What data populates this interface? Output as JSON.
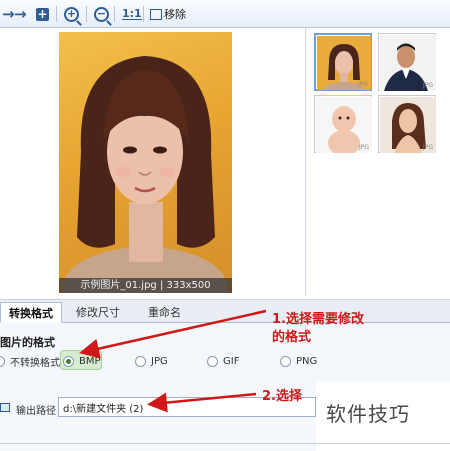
{
  "toolbar": {
    "icons": [
      "arrow-right-icon",
      "add-icon",
      "zoom-in-icon",
      "zoom-out-icon",
      "actual-size-icon",
      "remove-icon"
    ],
    "actual_size_label": "1:1",
    "remove_label": "移除"
  },
  "preview": {
    "caption": "示例图片_01.jpg | 333x500"
  },
  "thumbnails": [
    {
      "badge": "JPG"
    },
    {
      "badge": "JPG"
    },
    {
      "badge": "JPG"
    },
    {
      "badge": "JPG"
    }
  ],
  "tabs": [
    {
      "label": "转换格式",
      "active": true
    },
    {
      "label": "修改尺寸",
      "active": false
    },
    {
      "label": "重命名",
      "active": false
    }
  ],
  "format_section": {
    "title": "图片的格式",
    "options": [
      {
        "label": "不转换格式",
        "checked": false
      },
      {
        "label": "BMP",
        "checked": true
      },
      {
        "label": "JPG",
        "checked": false
      },
      {
        "label": "GIF",
        "checked": false
      },
      {
        "label": "PNG",
        "checked": false
      }
    ]
  },
  "output": {
    "label": "输出路径",
    "value": "d:\\新建文件夹 (2)"
  },
  "annotations": {
    "step1_line1": "1.选择需要修改",
    "step1_line2": "的格式",
    "step2": "2.选择"
  },
  "watermark": "软件技巧",
  "colors": {
    "annotation": "#d01818",
    "accent": "#2f5d93",
    "selected_radio": "#3d7e2e"
  }
}
